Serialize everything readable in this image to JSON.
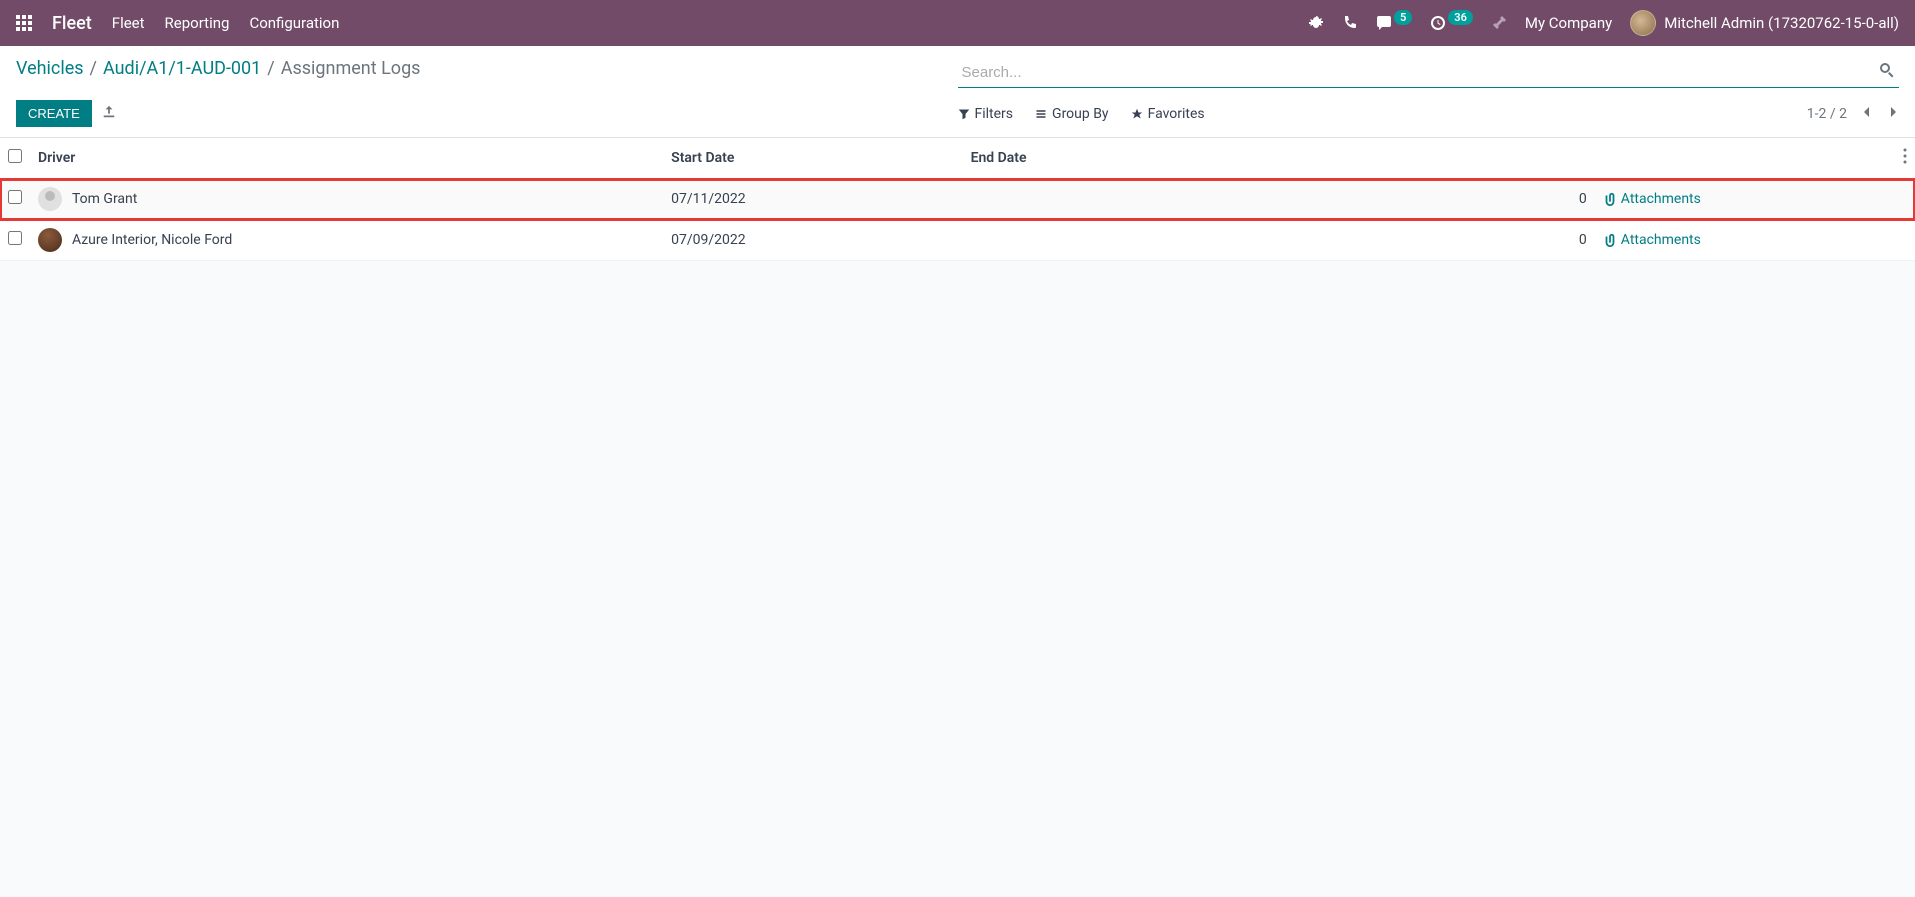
{
  "navbar": {
    "brand": "Fleet",
    "menu": [
      "Fleet",
      "Reporting",
      "Configuration"
    ],
    "messaging_badge": "5",
    "activity_badge": "36",
    "company": "My Company",
    "user": "Mitchell Admin (17320762-15-0-all)"
  },
  "breadcrumb": {
    "items": [
      "Vehicles",
      "Audi/A1/1-AUD-001"
    ],
    "current": "Assignment Logs"
  },
  "search": {
    "placeholder": "Search..."
  },
  "buttons": {
    "create": "CREATE"
  },
  "search_options": {
    "filters": "Filters",
    "groupby": "Group By",
    "favorites": "Favorites"
  },
  "pager": {
    "range": "1-2",
    "sep": "/",
    "total": "2"
  },
  "table": {
    "headers": {
      "driver": "Driver",
      "start_date": "Start Date",
      "end_date": "End Date"
    },
    "rows": [
      {
        "driver": "Tom Grant",
        "start_date": "07/11/2022",
        "end_date": "",
        "count": "0",
        "attachments": "Attachments",
        "highlighted": true,
        "avatar_type": "placeholder"
      },
      {
        "driver": "Azure Interior, Nicole Ford",
        "start_date": "07/09/2022",
        "end_date": "",
        "count": "0",
        "attachments": "Attachments",
        "highlighted": false,
        "avatar_type": "photo"
      }
    ]
  }
}
